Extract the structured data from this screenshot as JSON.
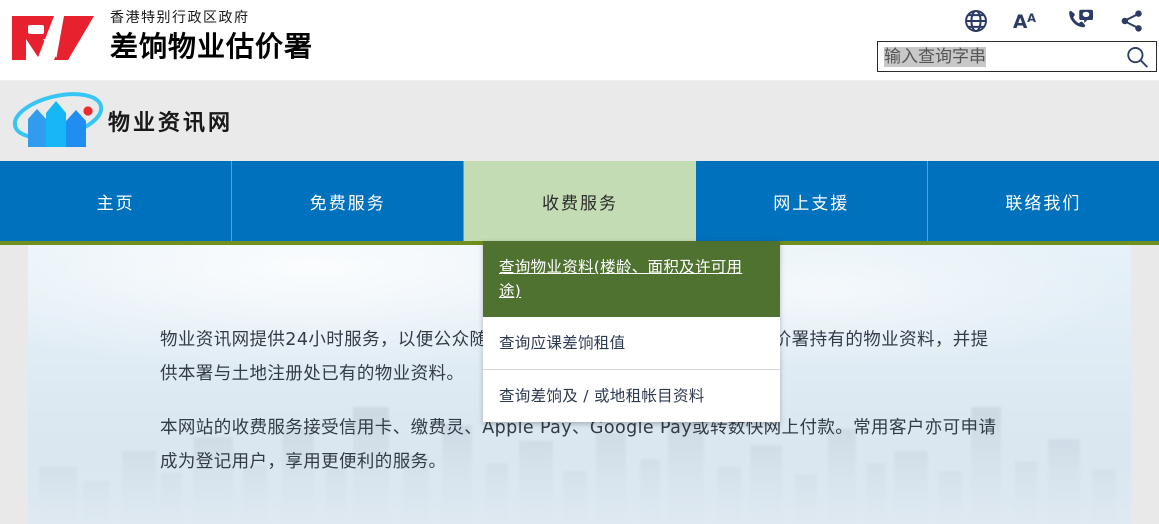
{
  "header": {
    "department_sub_title": "香港特别行政区政府",
    "department_title": "差饷物业估价署",
    "logo_text": "RV",
    "icons": [
      {
        "name": "globe-icon",
        "label": "语言"
      },
      {
        "name": "text-size-icon",
        "label": "字体大小"
      },
      {
        "name": "contact-icon",
        "label": "联络"
      },
      {
        "name": "share-icon",
        "label": "分享"
      }
    ],
    "search": {
      "placeholder": "输入查询字串",
      "value": "输入查询字串",
      "button_label": "搜寻"
    }
  },
  "site": {
    "logo_text": "物业资讯网"
  },
  "nav": {
    "items": [
      {
        "label": "主页",
        "active": false
      },
      {
        "label": "免费服务",
        "active": false
      },
      {
        "label": "收费服务",
        "active": true
      },
      {
        "label": "网上支援",
        "active": false
      },
      {
        "label": "联络我们",
        "active": false
      }
    ]
  },
  "dropdown": {
    "items": [
      {
        "label": "查询物业资料(楼龄、面积及许可用途)",
        "selected": true
      },
      {
        "label": "查询应课差饷租值",
        "selected": false
      },
      {
        "label": "查询差饷及 / 或地租帐目资料",
        "selected": false
      }
    ]
  },
  "hero": {
    "paragraphs": [
      "物业资讯网提供24小时服务，以便公众随时随地透过互联网，查阅差饷物业估价署持有的物业资料，并提供本署与土地注册处已有的物业资料。",
      "本网站的收费服务接受信用卡、缴费灵、Apple Pay、Google Pay或转数快网上付款。常用客户亦可申请成为登记用户，享用更便利的服务。"
    ]
  },
  "colors": {
    "nav_blue": "#0071bc",
    "nav_active_green": "#c3dcb4",
    "nav_underline_green": "#6f8f1f",
    "dropdown_selected_green": "#4f7230",
    "logo_red": "#e8212e",
    "icon_navy": "#2c3a66"
  }
}
